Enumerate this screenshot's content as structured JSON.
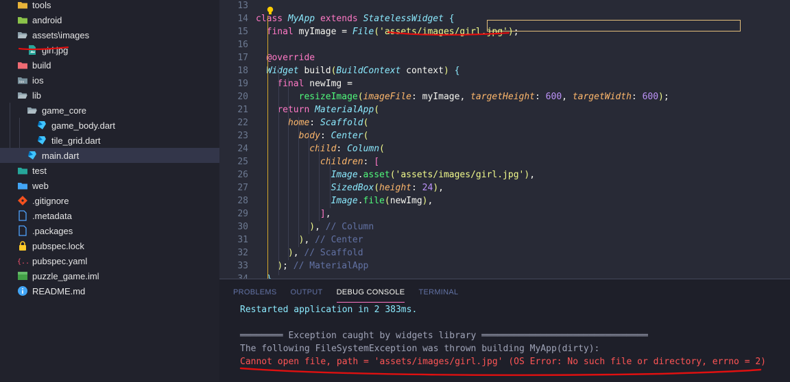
{
  "explorer": {
    "items": [
      {
        "label": "tools",
        "type": "folder",
        "icon": "folder-icon",
        "chev": "›",
        "depth": 0
      },
      {
        "label": "android",
        "type": "folder",
        "icon": "android-folder-icon",
        "chev": "›",
        "depth": 0
      },
      {
        "label": "assets\\images",
        "type": "folder-open",
        "icon": "folder-open-icon",
        "chev": "⌄",
        "depth": 0
      },
      {
        "label": "girl.jpg",
        "type": "image",
        "icon": "image-file-icon",
        "chev": "",
        "depth": 1
      },
      {
        "label": "build",
        "type": "folder",
        "icon": "build-folder-icon",
        "chev": "›",
        "depth": 0
      },
      {
        "label": "ios",
        "type": "folder",
        "icon": "ios-folder-icon",
        "chev": "›",
        "depth": 0
      },
      {
        "label": "lib",
        "type": "folder-open",
        "icon": "folder-open-icon",
        "chev": "⌄",
        "depth": 0
      },
      {
        "label": "game_core",
        "type": "folder-open",
        "icon": "folder-open-icon",
        "chev": "⌄",
        "depth": 1
      },
      {
        "label": "game_body.dart",
        "type": "dart",
        "icon": "dart-file-icon",
        "chev": "",
        "depth": 2
      },
      {
        "label": "tile_grid.dart",
        "type": "dart",
        "icon": "dart-file-icon",
        "chev": "",
        "depth": 2
      },
      {
        "label": "main.dart",
        "type": "dart",
        "icon": "dart-file-icon",
        "chev": "",
        "depth": 1,
        "selected": true
      },
      {
        "label": "test",
        "type": "folder",
        "icon": "test-folder-icon",
        "chev": "›",
        "depth": 0
      },
      {
        "label": "web",
        "type": "folder",
        "icon": "web-folder-icon",
        "chev": "›",
        "depth": 0
      },
      {
        "label": ".gitignore",
        "type": "git",
        "icon": "git-icon",
        "chev": "",
        "depth": 0
      },
      {
        "label": ".metadata",
        "type": "file",
        "icon": "file-icon",
        "chev": "",
        "depth": 0
      },
      {
        "label": ".packages",
        "type": "file",
        "icon": "file-icon",
        "chev": "",
        "depth": 0
      },
      {
        "label": "pubspec.lock",
        "type": "lock",
        "icon": "lock-icon",
        "chev": "",
        "depth": 0
      },
      {
        "label": "pubspec.yaml",
        "type": "yaml",
        "icon": "yaml-icon",
        "chev": "",
        "depth": 0
      },
      {
        "label": "puzzle_game.iml",
        "type": "iml",
        "icon": "iml-icon",
        "chev": "",
        "depth": 0
      },
      {
        "label": "README.md",
        "type": "info",
        "icon": "info-icon",
        "chev": "",
        "depth": 0
      }
    ]
  },
  "editor": {
    "lines": [
      {
        "n": "13",
        "code": ""
      },
      {
        "n": "14",
        "code": "class MyApp extends StatelessWidget {"
      },
      {
        "n": "15",
        "code": "  final myImage = File('assets/images/girl.jpg');"
      },
      {
        "n": "16",
        "code": ""
      },
      {
        "n": "17",
        "code": "  @override"
      },
      {
        "n": "18",
        "code": "  Widget build(BuildContext context) {"
      },
      {
        "n": "19",
        "code": "    final newImg ="
      },
      {
        "n": "20",
        "code": "        resizeImage(imageFile: myImage, targetHeight: 600, targetWidth: 600);"
      },
      {
        "n": "21",
        "code": "    return MaterialApp("
      },
      {
        "n": "22",
        "code": "      home: Scaffold("
      },
      {
        "n": "23",
        "code": "        body: Center("
      },
      {
        "n": "24",
        "code": "          child: Column("
      },
      {
        "n": "25",
        "code": "            children: ["
      },
      {
        "n": "26",
        "code": "              Image.asset('assets/images/girl.jpg'),"
      },
      {
        "n": "27",
        "code": "              SizedBox(height: 24),"
      },
      {
        "n": "28",
        "code": "              Image.file(newImg),"
      },
      {
        "n": "29",
        "code": "            ],"
      },
      {
        "n": "30",
        "code": "          ), // Column"
      },
      {
        "n": "31",
        "code": "        ), // Center"
      },
      {
        "n": "32",
        "code": "      ), // Scaffold"
      },
      {
        "n": "33",
        "code": "    ); // MaterialApp"
      },
      {
        "n": "34",
        "code": "  }"
      }
    ]
  },
  "panel": {
    "tabs": [
      "PROBLEMS",
      "OUTPUT",
      "DEBUG CONSOLE",
      "TERMINAL"
    ],
    "active_tab": "DEBUG CONSOLE",
    "console": [
      {
        "text": "Restarted application in 2 383ms.",
        "kind": "info"
      },
      {
        "text": "",
        "kind": "plain"
      },
      {
        "text": "════════ Exception caught by widgets library ═══════════════════════════════",
        "kind": "plain"
      },
      {
        "text": "The following FileSystemException was thrown building MyApp(dirty):",
        "kind": "plain"
      },
      {
        "text": "Cannot open file, path = 'assets/images/girl.jpg' (OS Error: No such file or directory, errno = 2)",
        "kind": "err"
      }
    ]
  },
  "colors": {
    "sidebar_bg": "#21222c",
    "editor_bg": "#282a36",
    "keyword": "#ff79c6",
    "type": "#8be9fd",
    "string": "#f1fa8c",
    "number": "#bd93f9",
    "error": "#ff5555",
    "annotation_red": "#e01010"
  }
}
